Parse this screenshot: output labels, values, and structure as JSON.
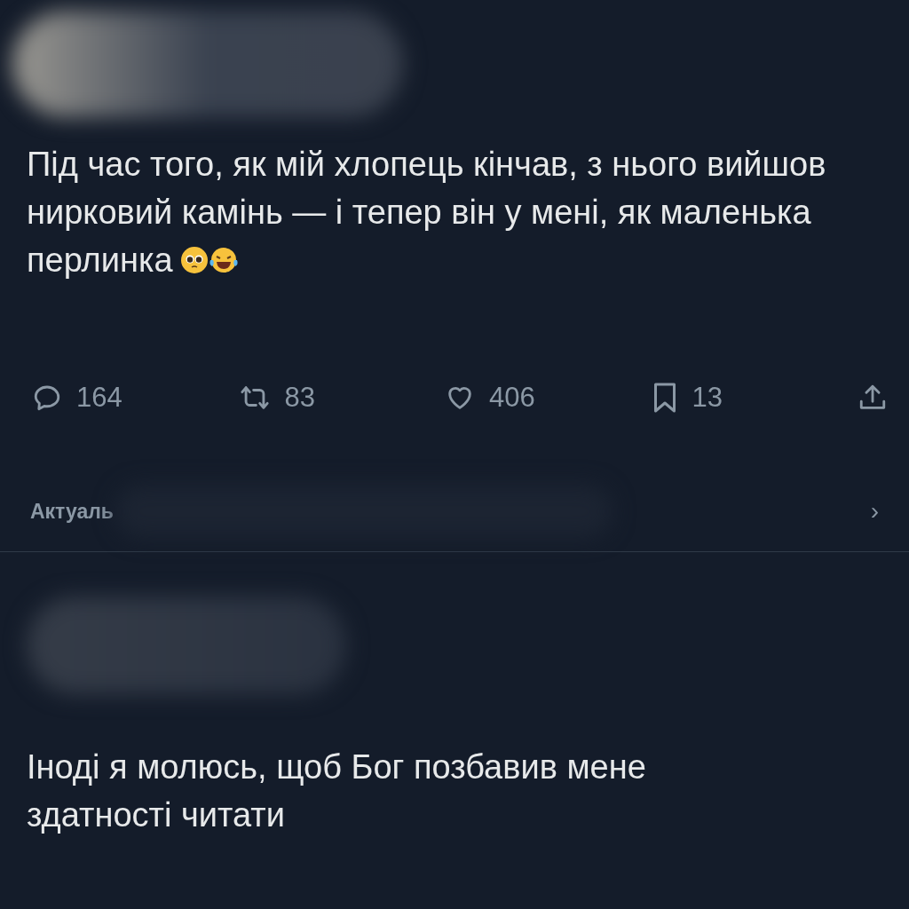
{
  "posts": [
    {
      "text_lines": [
        "Під час того, як мій хлопець кінчав, з нього вийшов",
        "нирковий камінь — і тепер він у мені, як маленька",
        "перлинка"
      ],
      "emojis": [
        {
          "kind": "pleading"
        },
        {
          "kind": "laughing"
        }
      ],
      "actions": [
        {
          "kind": "reply",
          "count": "164"
        },
        {
          "kind": "repost",
          "count": "83"
        },
        {
          "kind": "like",
          "count": "406"
        },
        {
          "kind": "bookmark",
          "count": "13"
        },
        {
          "kind": "share"
        }
      ],
      "related": {
        "label": "Актуаль",
        "chevron": "›"
      }
    },
    {
      "text_lines": [
        "Іноді я молюсь, щоб Бог позбавив мене",
        "здатності читати"
      ]
    }
  ]
}
